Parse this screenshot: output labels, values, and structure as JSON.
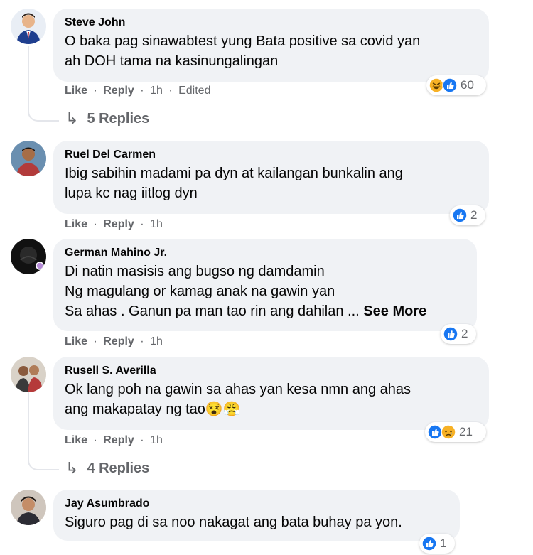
{
  "colors": {
    "bubble": "#f0f2f5",
    "meta_text": "#65676b",
    "like_blue": "#1877f2",
    "haha_yellow": "#f7b125",
    "sad_yellow": "#f7b125"
  },
  "comments": [
    {
      "author": "Steve John",
      "text": "O baka pag sinawabtest yung Bata positive sa covid yan\nah DOH tama na kasinungalingan",
      "like": "Like",
      "reply": "Reply",
      "time": "1h",
      "edited": "Edited",
      "reactions": [
        "haha-icon",
        "like-icon"
      ],
      "reaction_count": "60",
      "replies_label": "5 Replies"
    },
    {
      "author": "Ruel Del Carmen",
      "text": "Ibig sabihin madami pa dyn at kailangan bunkalin ang\nlupa kc nag iitlog dyn",
      "like": "Like",
      "reply": "Reply",
      "time": "1h",
      "reactions": [
        "like-icon"
      ],
      "reaction_count": "2"
    },
    {
      "author": "German Mahino Jr.",
      "text": "Di natin masisis ang bugso ng damdamin\nNg magulang or kamag anak na gawin yan\nSa ahas . Ganun pa man tao rin ang dahilan ...",
      "see_more": "See More",
      "like": "Like",
      "reply": "Reply",
      "time": "1h",
      "reactions": [
        "like-icon"
      ],
      "reaction_count": "2"
    },
    {
      "author": "Rusell S. Averilla",
      "text": "Ok lang poh na gawin sa ahas yan kesa nmn ang ahas\nang makapatay ng tao😵😤",
      "like": "Like",
      "reply": "Reply",
      "time": "1h",
      "reactions": [
        "like-icon",
        "sad-icon"
      ],
      "reaction_count": "21",
      "replies_label": "4 Replies"
    },
    {
      "author": "Jay Asumbrado",
      "text": "Siguro pag di sa noo nakagat ang bata buhay pa yon.",
      "reactions": [
        "like-icon"
      ],
      "reaction_count": "1"
    }
  ],
  "separators": {
    "dot": "·"
  },
  "icons": {
    "reply_arrow": "↳"
  }
}
